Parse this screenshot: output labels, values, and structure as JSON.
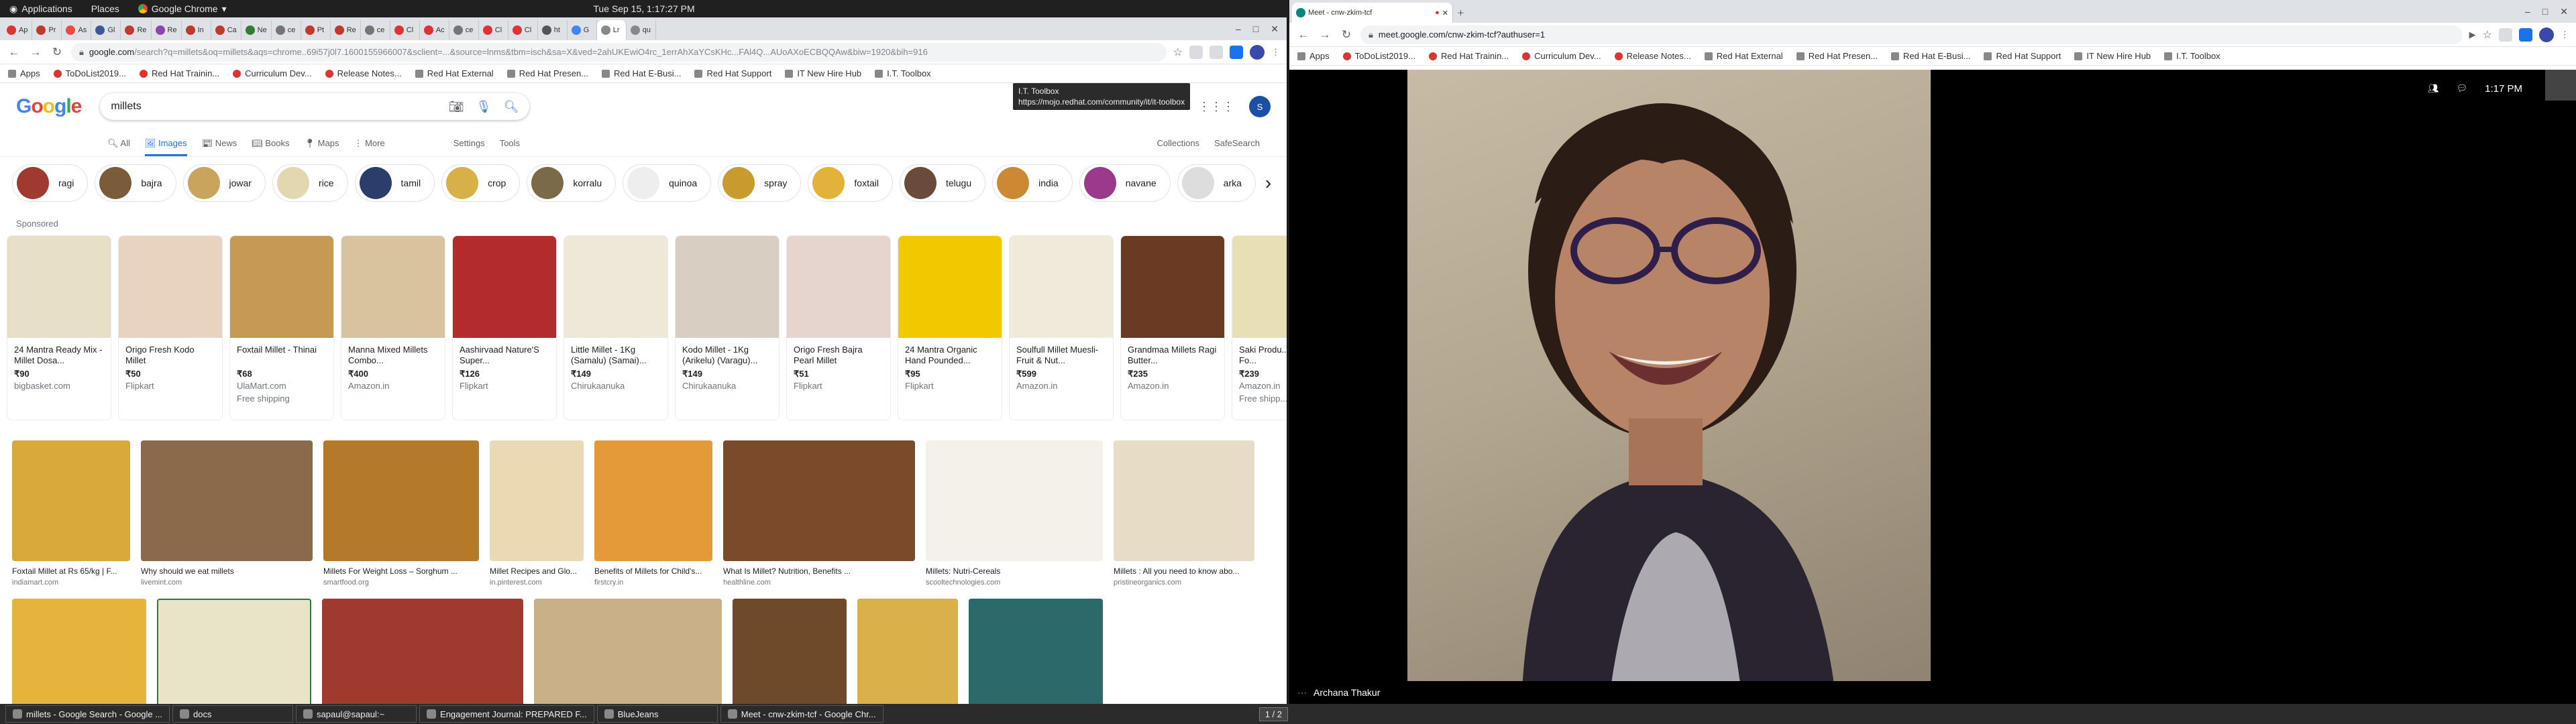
{
  "topbar": {
    "applications": "Applications",
    "places": "Places",
    "chrome": "Google Chrome",
    "clock": "Tue Sep 15, 1:17:27 PM"
  },
  "left_browser": {
    "tabs": [
      "Ap",
      "Pr",
      "As",
      "Gl",
      "Re",
      "Re",
      "In",
      "Ca",
      "Ne",
      "ce",
      "Pt",
      "Re",
      "ce",
      "Cl",
      "Ac",
      "ce",
      "Cl",
      "Cl",
      "ht",
      "G",
      "Lr",
      "qu"
    ],
    "url_host": "google.com",
    "url_rest": "/search?q=millets&oq=millets&aqs=chrome..69i57j0l7.1600155966007&sclient=...&source=lnms&tbm=isch&sa=X&ved=2ahUKEwiO4rc_1errAhXaYCsKHc...FAl4Q...AUoAXoECBQQAw&biw=1920&bih=916",
    "bookmarks": [
      "Apps",
      "ToDoList2019...",
      "Red Hat Trainin...",
      "Curriculum Dev...",
      "Release Notes...",
      "Red Hat External",
      "Red Hat Presen...",
      "Red Hat E-Busi...",
      "Red Hat Support",
      "IT New Hire Hub",
      "I.T. Toolbox"
    ],
    "tooltip_title": "I.T. Toolbox",
    "tooltip_url": "https://mojo.redhat.com/community/it/it-toolbox",
    "search_query": "millets",
    "search_tabs": [
      "All",
      "Images",
      "News",
      "Books",
      "Maps",
      "More"
    ],
    "settings": "Settings",
    "tools": "Tools",
    "collections": "Collections",
    "safesearch": "SafeSearch",
    "chips": [
      "ragi",
      "bajra",
      "jowar",
      "rice",
      "tamil",
      "crop",
      "korralu",
      "quinoa",
      "spray",
      "foxtail",
      "telugu",
      "india",
      "navane",
      "arka"
    ],
    "sponsored": "Sponsored",
    "products": [
      {
        "title": "24 Mantra Ready Mix - Millet Dosa...",
        "price": "₹90",
        "store": "bigbasket.com",
        "ship": ""
      },
      {
        "title": "Origo Fresh Kodo Millet",
        "price": "₹50",
        "store": "Flipkart",
        "ship": ""
      },
      {
        "title": "Foxtail Millet - Thinai",
        "price": "₹68",
        "store": "UlaMart.com",
        "ship": "Free shipping"
      },
      {
        "title": "Manna Mixed Millets Combo...",
        "price": "₹400",
        "store": "Amazon.in",
        "ship": ""
      },
      {
        "title": "Aashirvaad Nature'S Super...",
        "price": "₹126",
        "store": "Flipkart",
        "ship": ""
      },
      {
        "title": "Little Millet - 1Kg (Samalu) (Samai)...",
        "price": "₹149",
        "store": "Chirukaanuka",
        "ship": ""
      },
      {
        "title": "Kodo Millet - 1Kg (Arikelu) (Varagu)...",
        "price": "₹149",
        "store": "Chirukaanuka",
        "ship": ""
      },
      {
        "title": "Origo Fresh Bajra Pearl Millet",
        "price": "₹51",
        "store": "Flipkart",
        "ship": ""
      },
      {
        "title": "24 Mantra Organic Hand Pounded...",
        "price": "₹95",
        "store": "Flipkart",
        "ship": ""
      },
      {
        "title": "Soulfull Millet Muesli- Fruit & Nut...",
        "price": "₹599",
        "store": "Amazon.in",
        "ship": ""
      },
      {
        "title": "Grandmaa Millets Ragi Butter...",
        "price": "₹235",
        "store": "Amazon.in",
        "ship": ""
      },
      {
        "title": "Saki Produ... Fasting Fo...",
        "price": "₹239",
        "store": "Amazon.in",
        "ship": "Free shipp..."
      }
    ],
    "images": [
      {
        "cap": "Foxtail Millet at Rs 65/kg | F...",
        "src": "indiamart.com"
      },
      {
        "cap": "Why should we eat millets",
        "src": "livemint.com"
      },
      {
        "cap": "Millets For Weight Loss – Sorghum ...",
        "src": "smartfood.org"
      },
      {
        "cap": "Millet Recipes and Glo...",
        "src": "in.pinterest.com"
      },
      {
        "cap": "Benefits of Millets for Child's...",
        "src": "firstcry.in"
      },
      {
        "cap": "What Is Millet? Nutrition, Benefits ...",
        "src": "healthline.com"
      },
      {
        "cap": "Millets: Nutri-Cereals",
        "src": "scooltechnologies.com"
      },
      {
        "cap": "Millets : All you need to know abo...",
        "src": "pristineorganics.com"
      }
    ]
  },
  "right_browser": {
    "tab_title": "Meet - cnw-zkim-tcf",
    "url": "meet.google.com/cnw-zkim-tcf?authuser=1",
    "bookmarks": [
      "Apps",
      "ToDoList2019...",
      "Red Hat Trainin...",
      "Curriculum Dev...",
      "Release Notes...",
      "Red Hat External",
      "Red Hat Presen...",
      "Red Hat E-Busi...",
      "Red Hat Support",
      "IT New Hire Hub",
      "I.T. Toolbox"
    ],
    "meet_time": "1:17 PM",
    "participant": "Archana Thakur"
  },
  "taskbar": {
    "items": [
      "millets - Google Search - Google ...",
      "docs",
      "sapaul@sapaul:~",
      "Engagement Journal: PREPARED F...",
      "BlueJeans",
      "Meet - cnw-zkim-tcf - Google Chr..."
    ],
    "workspace": "1 / 2"
  },
  "colors": {
    "google_blue": "#1a73e8",
    "meet_bg": "#000000",
    "topbar": "#202020"
  }
}
